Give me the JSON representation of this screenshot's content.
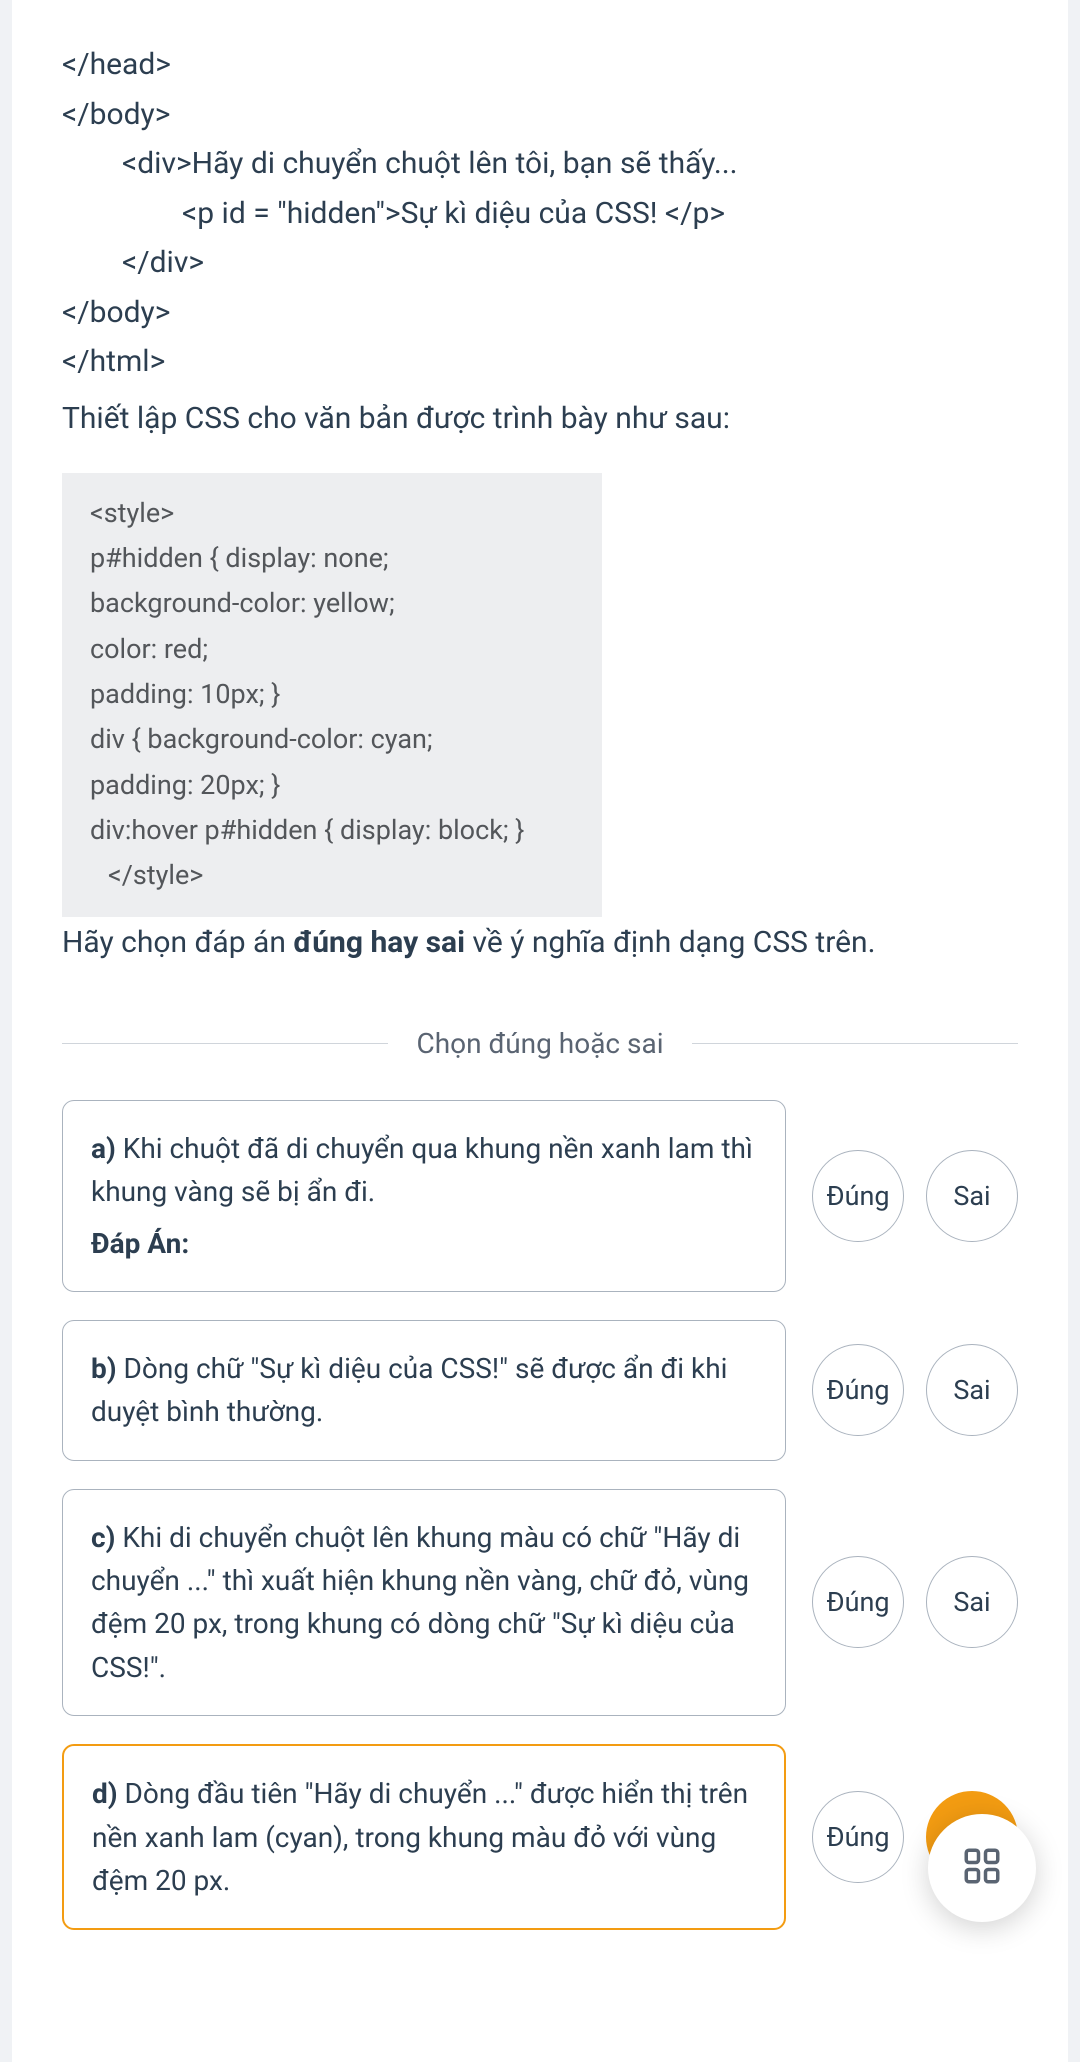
{
  "html_code": {
    "line1": "</head>",
    "line2": "</body>",
    "line3": "<div>Hãy di chuyển chuột lên tôi, bạn sẽ thấy...",
    "line4": "<p id = \"hidden\">Sự kì diệu của CSS! </p>",
    "line5": "</div>",
    "line6": "</body>",
    "line7": "</html>"
  },
  "desc1": "Thiết lập CSS cho văn bản được trình bày như sau:",
  "css_code": {
    "l1": "<style>",
    "l2": "p#hidden { display: none;",
    "l3": "background-color: yellow;",
    "l4": "color: red;",
    "l5": "padding: 10px; }",
    "l6": "div { background-color: cyan;",
    "l7": "padding: 20px; }",
    "l8": "div:hover p#hidden { display: block; }",
    "l9": "</style>"
  },
  "followup": {
    "prefix": "Hãy chọn đáp án ",
    "bold": "đúng hay sai",
    "suffix": " về ý nghĩa định dạng CSS trên."
  },
  "divider_label": "Chọn đúng hoặc sai",
  "buttons": {
    "true": "Đúng",
    "false": "Sai"
  },
  "answers_label": "Đáp Án:",
  "questions": [
    {
      "label": "a)",
      "text": " Khi chuột đã di chuyển qua khung nền xanh lam thì khung vàng sẽ bị ẩn đi.",
      "show_answer": true
    },
    {
      "label": "b)",
      "text": " Dòng chữ \"Sự kì diệu của CSS!\" sẽ được ẩn đi khi duyệt bình thường.",
      "show_answer": false
    },
    {
      "label": "c)",
      "text": " Khi di chuyển chuột lên khung màu có chữ \"Hãy di chuyển ...\" thì xuất hiện khung nền vàng, chữ đỏ, vùng đệm 20 px, trong khung có dòng chữ \"Sự kì diệu của CSS!\".",
      "show_answer": false
    },
    {
      "label": "d)",
      "text": " Dòng đầu tiên \"Hãy di chuyển ...\" được hiển thị trên nền xanh lam (cyan), trong khung màu đỏ với vùng đệm 20 px.",
      "show_answer": false
    }
  ]
}
